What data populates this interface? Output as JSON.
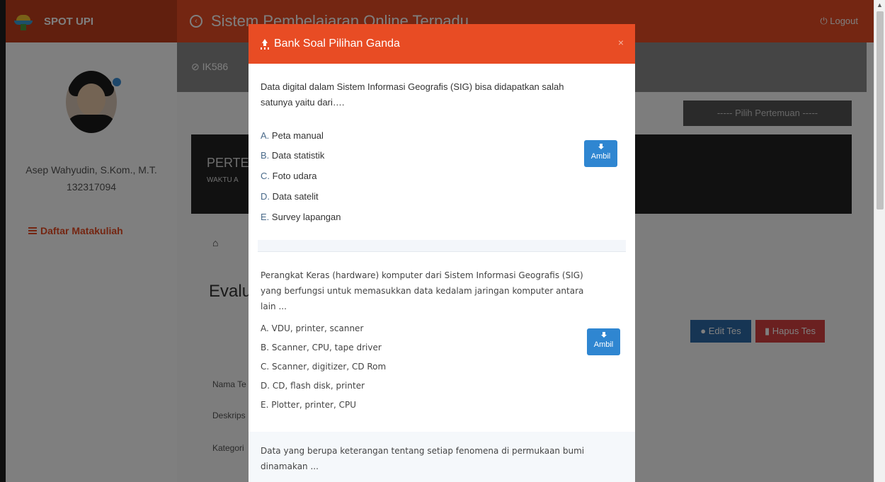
{
  "app": {
    "brand": "SPOT UPI",
    "title": "Sistem Pembelajaran Online Terpadu",
    "logout": "Logout"
  },
  "sidebar": {
    "user_name": "Asep Wahyudin, S.Kom., M.T.",
    "user_id": "132317094",
    "nav_item": "Daftar Matakuliah"
  },
  "main": {
    "course_code": "IK586",
    "pilih_pertemuan": "----- Pilih Pertemuan -----",
    "pertemuan_title": "PERTE",
    "pertemuan_sub": "WAKTU A",
    "evaluasi_title": "Evalu",
    "edit_label": "Edit Tes",
    "hapus_label": "Hapus Tes",
    "field_labels": [
      "Nama Te",
      "Deskrips",
      "Kategori"
    ]
  },
  "modal": {
    "title": "Bank Soal Pilihan Ganda",
    "close": "×",
    "ambil_label": "Ambil",
    "questions": [
      {
        "text": "Data digital dalam Sistem Informasi Geografis (SIG) bisa didapatkan salah satunya yaitu dari….",
        "options": [
          {
            "letter": "A.",
            "text": "Peta manual"
          },
          {
            "letter": "B.",
            "text": "Data statistik"
          },
          {
            "letter": "C.",
            "text": " Foto udara"
          },
          {
            "letter": "D.",
            "text": "Data satelit"
          },
          {
            "letter": "E.",
            "text": "Survey lapangan"
          }
        ]
      },
      {
        "text": "Perangkat Keras (hardware) komputer dari Sistem Informasi Geografis (SIG) yang berfungsi untuk memasukkan data kedalam jaringan komputer antara lain ...",
        "options": [
          {
            "letter": "A.",
            "text": "VDU, printer, scanner"
          },
          {
            "letter": "B.",
            "text": "Scanner, CPU, tape driver"
          },
          {
            "letter": "C.",
            "text": "Scanner, digitizer, CD Rom"
          },
          {
            "letter": "D.",
            "text": "CD, flash disk, printer"
          },
          {
            "letter": "E.",
            "text": "Plotter, printer, CPU"
          }
        ]
      },
      {
        "text": "Data yang berupa keterangan tentang setiap fenomena di permukaan bumi dinamakan ..."
      }
    ]
  },
  "colors": {
    "primary": "#e84c24",
    "ambil_button": "#2f86d1"
  }
}
